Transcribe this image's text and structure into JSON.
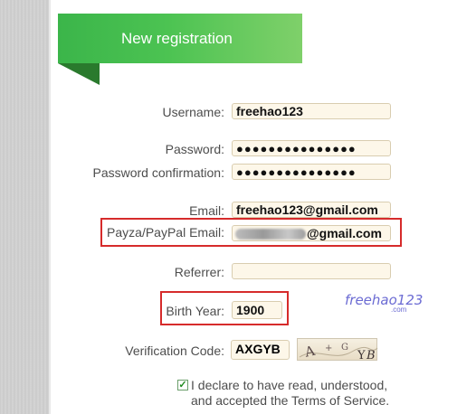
{
  "header": {
    "title": "New registration"
  },
  "form": {
    "username": {
      "label": "Username:",
      "value": "freehao123"
    },
    "password": {
      "label": "Password:",
      "value": "●●●●●●●●●●●●●●●"
    },
    "password_confirmation": {
      "label": "Password confirmation:",
      "value": "●●●●●●●●●●●●●●●"
    },
    "email": {
      "label": "Email:",
      "value": "freehao123@gmail.com"
    },
    "payza_email": {
      "label": "Payza/PayPal Email:",
      "value_suffix": "@gmail.com"
    },
    "referrer": {
      "label": "Referrer:",
      "value": ""
    },
    "birth_year": {
      "label": "Birth Year:",
      "value": "1900"
    },
    "verification": {
      "label": "Verification Code:",
      "value": "AXGYB",
      "captcha_letters": "A  + G  YB"
    }
  },
  "watermark": {
    "text": "freehao123",
    "sub": ".com"
  },
  "terms": {
    "checked": true,
    "line1": "I declare to have read, understood,",
    "line2": "and accepted the Terms of Service."
  },
  "colors": {
    "ribbon": "#4cc352",
    "highlight": "#d62b2b",
    "field_bg": "#fdf7e9"
  }
}
